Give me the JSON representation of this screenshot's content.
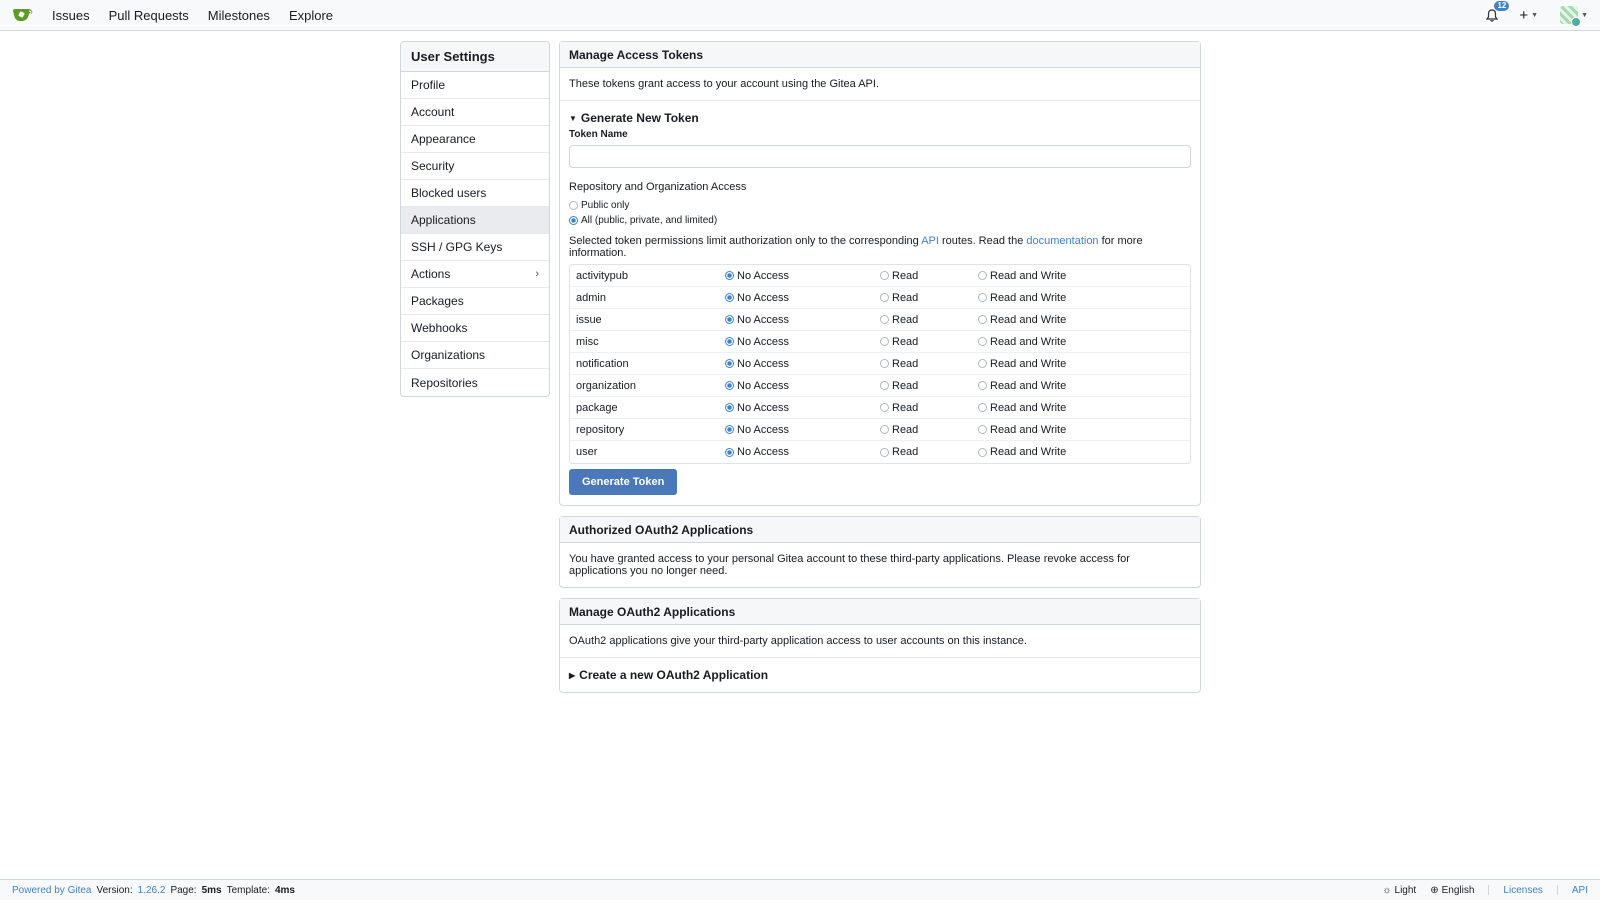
{
  "nav": {
    "logo_icon": "gitea-logo-icon",
    "items": [
      "Issues",
      "Pull Requests",
      "Milestones",
      "Explore"
    ],
    "notification_count": "12",
    "plus_label": "+"
  },
  "sidebar": {
    "title": "User Settings",
    "items": [
      {
        "label": "Profile"
      },
      {
        "label": "Account"
      },
      {
        "label": "Appearance"
      },
      {
        "label": "Security"
      },
      {
        "label": "Blocked users"
      },
      {
        "label": "Applications",
        "active": true
      },
      {
        "label": "SSH / GPG Keys"
      },
      {
        "label": "Actions",
        "has_submenu": true
      },
      {
        "label": "Packages"
      },
      {
        "label": "Webhooks"
      },
      {
        "label": "Organizations"
      },
      {
        "label": "Repositories"
      }
    ]
  },
  "tokens": {
    "title": "Manage Access Tokens",
    "description": "These tokens grant access to your account using the Gitea API.",
    "generate_summary": "Generate New Token",
    "token_name_label": "Token Name",
    "token_name_value": "",
    "access_label": "Repository and Organization Access",
    "access_options": [
      "Public only",
      "All (public, private, and limited)"
    ],
    "access_selected": "All (public, private, and limited)",
    "permission_note_pre": "Selected token permissions limit authorization only to the corresponding ",
    "permission_note_api": "API",
    "permission_note_mid": " routes. Read the ",
    "permission_note_doc": "documentation",
    "permission_note_post": " for more information.",
    "permission_levels": [
      "No Access",
      "Read",
      "Read and Write"
    ],
    "scopes": [
      {
        "name": "activitypub",
        "selected": "No Access"
      },
      {
        "name": "admin",
        "selected": "No Access"
      },
      {
        "name": "issue",
        "selected": "No Access"
      },
      {
        "name": "misc",
        "selected": "No Access"
      },
      {
        "name": "notification",
        "selected": "No Access"
      },
      {
        "name": "organization",
        "selected": "No Access"
      },
      {
        "name": "package",
        "selected": "No Access"
      },
      {
        "name": "repository",
        "selected": "No Access"
      },
      {
        "name": "user",
        "selected": "No Access"
      }
    ],
    "generate_button": "Generate Token"
  },
  "authorized_oauth": {
    "title": "Authorized OAuth2 Applications",
    "description": "You have granted access to your personal Gitea account to these third-party applications. Please revoke access for applications you no longer need."
  },
  "manage_oauth": {
    "title": "Manage OAuth2 Applications",
    "description": "OAuth2 applications give your third-party application access to user accounts on this instance.",
    "create_summary": "Create a new OAuth2 Application"
  },
  "footer": {
    "powered_by": "Powered by Gitea",
    "version_label": "Version:",
    "version": "1.26.2",
    "page_label": "Page:",
    "page_time": "5ms",
    "template_label": "Template:",
    "template_time": "4ms",
    "theme": "Light",
    "language": "English",
    "licenses": "Licenses",
    "api": "API"
  },
  "colors": {
    "accent": "#4183c4",
    "button": "#4a78b8",
    "logo_green": "#609926"
  }
}
